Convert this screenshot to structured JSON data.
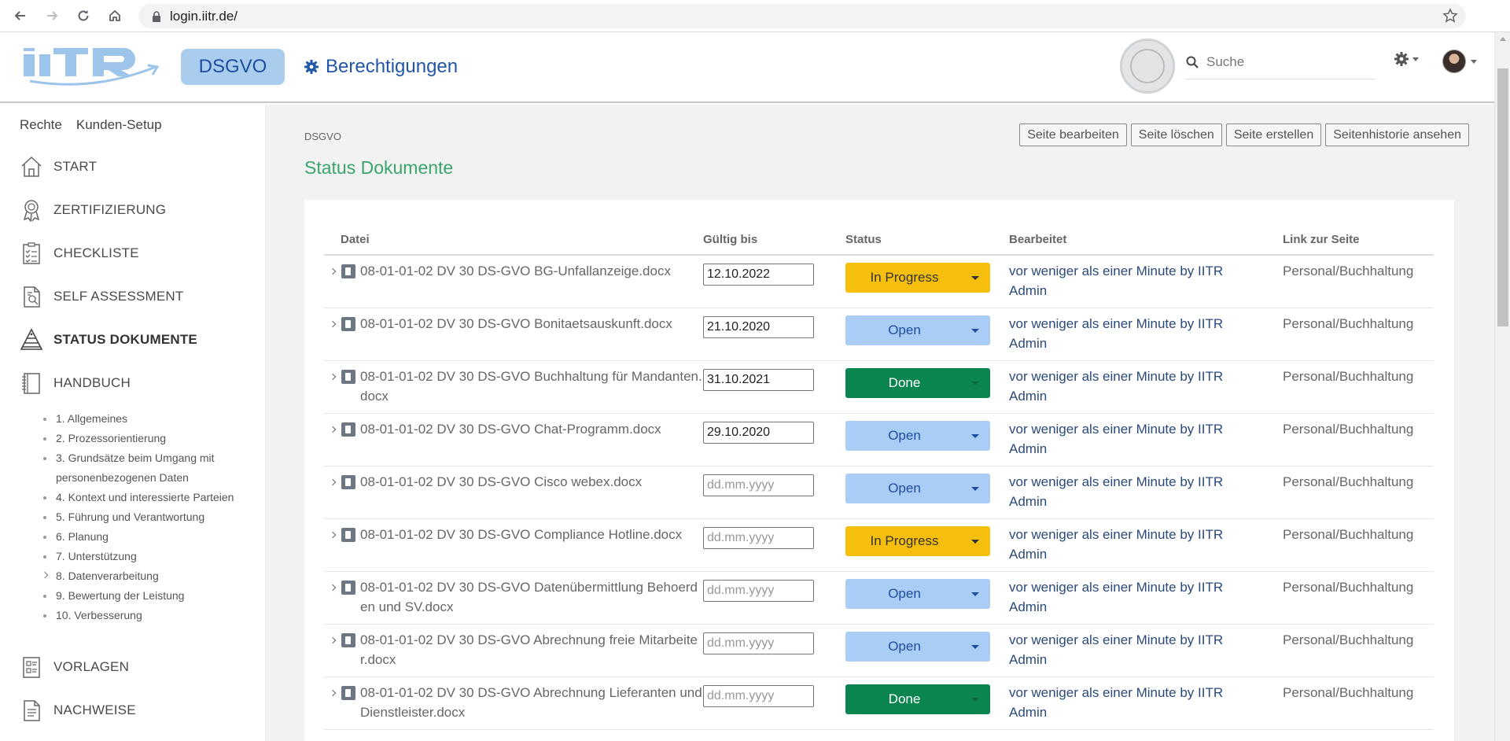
{
  "browser": {
    "url": "login.iitr.de/"
  },
  "header": {
    "module_button": "DSGVO",
    "permissions_link": "Berechtigungen",
    "search_placeholder": "Suche"
  },
  "sidebar": {
    "tabs": [
      "Rechte",
      "Kunden-Setup"
    ],
    "nav": [
      {
        "label": "START",
        "icon": "home-icon"
      },
      {
        "label": "ZERTIFIZIERUNG",
        "icon": "award-icon"
      },
      {
        "label": "CHECKLISTE",
        "icon": "checklist-icon"
      },
      {
        "label": "SELF ASSESSMENT",
        "icon": "self-assessment-icon"
      },
      {
        "label": "STATUS DOKUMENTE",
        "icon": "pyramid-icon"
      },
      {
        "label": "HANDBUCH",
        "icon": "notebook-icon"
      },
      {
        "label": "VORLAGEN",
        "icon": "templates-icon"
      },
      {
        "label": "NACHWEISE",
        "icon": "document-icon"
      }
    ],
    "handbook_items": [
      "1. Allgemeines",
      "2. Prozessorientierung",
      "3. Grundsätze beim Umgang mit personenbezogenen Daten",
      "4. Kontext und interessierte Parteien",
      "5. Führung und Verantwortung",
      "6. Planung",
      "7. Unterstützung",
      "8. Datenverarbeitung",
      "9. Bewertung der Leistung",
      "10. Verbesserung"
    ]
  },
  "page": {
    "breadcrumb": "DSGVO",
    "title": "Status Dokumente",
    "actions": [
      "Seite bearbeiten",
      "Seite löschen",
      "Seite erstellen",
      "Seitenhistorie ansehen"
    ]
  },
  "table": {
    "headers": [
      "Datei",
      "Gültig bis",
      "Status",
      "Bearbeitet",
      "Link zur Seite"
    ],
    "date_placeholder": "dd.mm.yyyy",
    "rows": [
      {
        "file": "08-01-01-02 DV 30 DS-GVO BG-Unfallanzeige.docx",
        "date": "12.10.2022",
        "status": "In Progress",
        "edited": "vor weniger als einer Minute by IITR Admin",
        "link": "Personal/Buchhaltung"
      },
      {
        "file": "08-01-01-02 DV 30 DS-GVO Bonitaetsauskunft.docx",
        "date": "21.10.2020",
        "status": "Open",
        "edited": "vor weniger als einer Minute by IITR Admin",
        "link": "Personal/Buchhaltung"
      },
      {
        "file": "08-01-01-02 DV 30 DS-GVO Buchhaltung für Mandanten.docx",
        "date": "31.10.2021",
        "status": "Done",
        "edited": "vor weniger als einer Minute by IITR Admin",
        "link": "Personal/Buchhaltung"
      },
      {
        "file": "08-01-01-02 DV 30 DS-GVO Chat-Programm.docx",
        "date": "29.10.2020",
        "status": "Open",
        "edited": "vor weniger als einer Minute by IITR Admin",
        "link": "Personal/Buchhaltung"
      },
      {
        "file": "08-01-01-02 DV 30 DS-GVO Cisco webex.docx",
        "date": "",
        "status": "Open",
        "edited": "vor weniger als einer Minute by IITR Admin",
        "link": "Personal/Buchhaltung"
      },
      {
        "file": "08-01-01-02 DV 30 DS-GVO Compliance Hotline.docx",
        "date": "",
        "status": "In Progress",
        "edited": "vor weniger als einer Minute by IITR Admin",
        "link": "Personal/Buchhaltung"
      },
      {
        "file": "08-01-01-02 DV 30 DS-GVO Datenübermittlung Behoerden und SV.docx",
        "date": "",
        "status": "Open",
        "edited": "vor weniger als einer Minute by IITR Admin",
        "link": "Personal/Buchhaltung"
      },
      {
        "file": "08-01-01-02 DV 30 DS-GVO Abrechnung freie Mitarbeiter.docx",
        "date": "",
        "status": "Open",
        "edited": "vor weniger als einer Minute by IITR Admin",
        "link": "Personal/Buchhaltung"
      },
      {
        "file": "08-01-01-02 DV 30 DS-GVO Abrechnung Lieferanten und Dienstleister.docx",
        "date": "",
        "status": "Done",
        "edited": "vor weniger als einer Minute by IITR Admin",
        "link": "Personal/Buchhaltung"
      }
    ]
  },
  "colors": {
    "in_progress": "#f7bf0d",
    "open": "#aacdf5",
    "done": "#0b8550",
    "title_green": "#3aa56b",
    "brand_blue": "#2156a8"
  }
}
